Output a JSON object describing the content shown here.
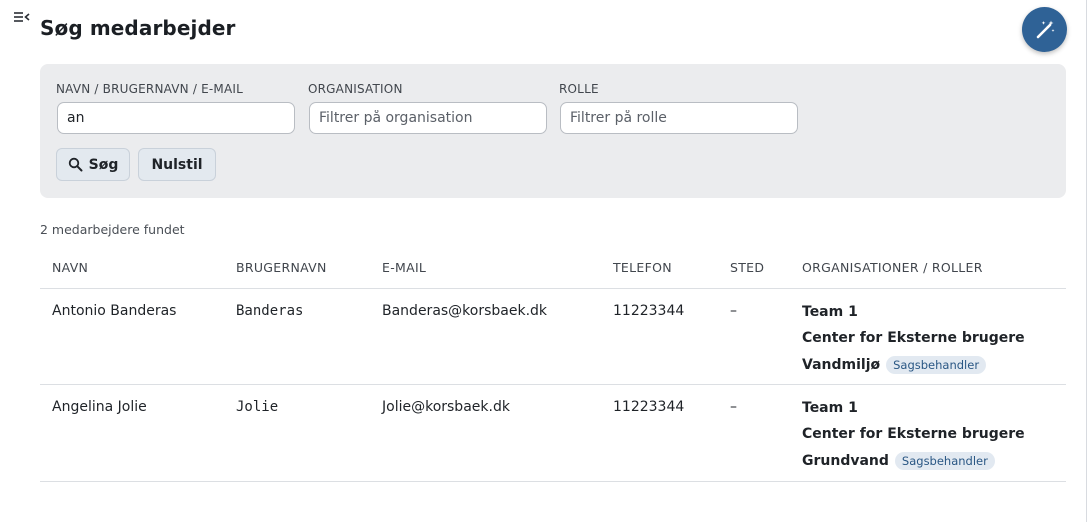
{
  "header": {
    "title": "Søg medarbejder",
    "menu_icon": "sidebar-collapse-icon",
    "fab_icon": "magic-wand-icon",
    "accent_color": "#2f6296"
  },
  "filters": {
    "name": {
      "label": "NAVN / BRUGERNAVN / E-MAIL",
      "value": "an",
      "placeholder": ""
    },
    "organisation": {
      "label": "ORGANISATION",
      "value": "",
      "placeholder": "Filtrer på organisation"
    },
    "role": {
      "label": "ROLLE",
      "value": "",
      "placeholder": "Filtrer på rolle"
    },
    "search_button": "Søg",
    "search_icon": "search-icon",
    "reset_button": "Nulstil"
  },
  "results": {
    "count_text": "2 medarbejdere fundet",
    "columns": [
      "NAVN",
      "BRUGERNAVN",
      "E-MAIL",
      "TELEFON",
      "STED",
      "ORGANISATIONER / ROLLER"
    ],
    "rows": [
      {
        "name": "Antonio Banderas",
        "username": "Banderas",
        "email": "Banderas@korsbaek.dk",
        "phone": "11223344",
        "location": "–",
        "orgs": [
          {
            "name": "Team 1"
          },
          {
            "name": "Center for Eksterne brugere"
          },
          {
            "name": "Vandmiljø",
            "role": "Sagsbehandler"
          }
        ]
      },
      {
        "name": "Angelina Jolie",
        "username": "Jolie",
        "email": "Jolie@korsbaek.dk",
        "phone": "11223344",
        "location": "–",
        "orgs": [
          {
            "name": "Team 1"
          },
          {
            "name": "Center for Eksterne brugere"
          },
          {
            "name": "Grundvand",
            "role": "Sagsbehandler"
          }
        ]
      }
    ]
  }
}
